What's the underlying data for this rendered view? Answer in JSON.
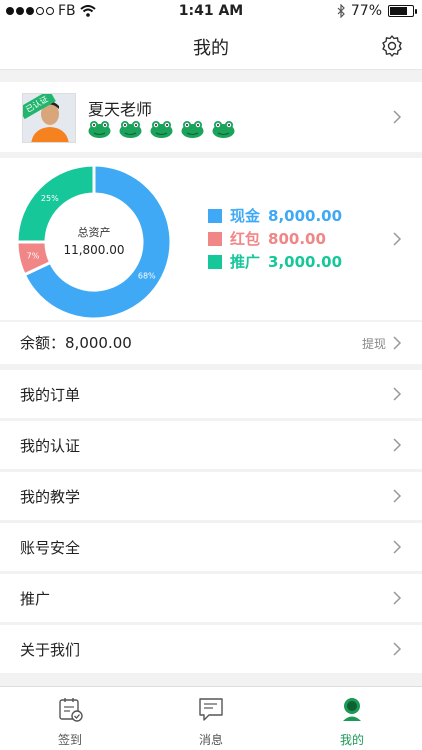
{
  "status_bar": {
    "carrier": "FB",
    "time": "1:41 AM",
    "battery": "77%",
    "battery_level": 0.77
  },
  "nav": {
    "title": "我的",
    "settings_icon": "gear-icon"
  },
  "profile": {
    "name": "夏天老师",
    "badge": "已认证",
    "frog_count": 5
  },
  "assets": {
    "center_label": "总资产",
    "center_value": "11,800.00",
    "legend": [
      {
        "label": "现金",
        "value": "8,000.00",
        "color": "#3fa9f5"
      },
      {
        "label": "红包",
        "value": "800.00",
        "color": "#f08686"
      },
      {
        "label": "推广",
        "value": "3,000.00",
        "color": "#16c79a"
      }
    ]
  },
  "chart_data": {
    "type": "pie",
    "categories": [
      "现金",
      "红包",
      "推广"
    ],
    "values": [
      68,
      7,
      25
    ],
    "value_labels": [
      "68%",
      "7%",
      "25%"
    ],
    "colors": [
      "#3fa9f5",
      "#f08686",
      "#16c79a"
    ],
    "title": "总资产",
    "center_value": "11,800.00"
  },
  "balance": {
    "label": "余额：",
    "value": "8,000.00",
    "action": "提现"
  },
  "menu": [
    {
      "label": "我的订单"
    },
    {
      "label": "我的认证"
    },
    {
      "label": "我的教学"
    },
    {
      "label": "账号安全"
    },
    {
      "label": "推广"
    },
    {
      "label": "关于我们"
    }
  ],
  "tabs": [
    {
      "label": "签到",
      "icon": "calendar-check-icon"
    },
    {
      "label": "消息",
      "icon": "message-icon"
    },
    {
      "label": "我的",
      "icon": "user-icon"
    }
  ],
  "colors": {
    "accent": "#1a9a55",
    "brand_green": "#22b56e"
  }
}
